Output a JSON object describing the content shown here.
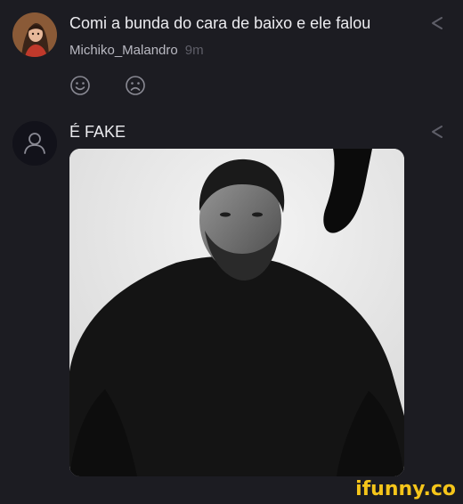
{
  "comments": [
    {
      "text": "Comi a bunda do cara de baixo e ele falou",
      "username": "Michiko_Malandro",
      "timestamp": "9m",
      "share_icon": "share-icon",
      "reactions": [
        "smile-icon",
        "frown-icon"
      ]
    },
    {
      "text": "É FAKE",
      "avatar_icon": "default-user-icon",
      "share_icon": "share-icon",
      "image": "photo of a muscular bearded man in a black sweater"
    }
  ],
  "watermark": "ifunny.co",
  "colors": {
    "background": "#1c1c22",
    "text": "#ececf0",
    "username": "#b9b9c2",
    "muted": "#5e5e68",
    "brand": "#f5c51a"
  }
}
